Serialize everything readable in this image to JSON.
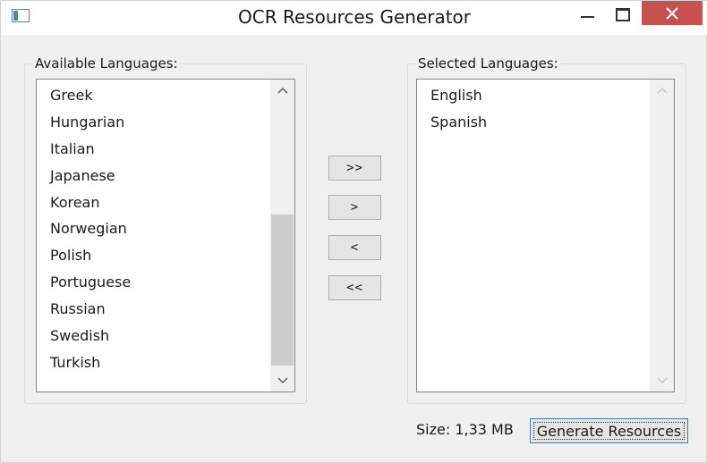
{
  "window": {
    "title": "OCR Resources Generator",
    "icons": {
      "app": "app-window-icon",
      "minimize": "minimize-icon",
      "maximize": "maximize-icon",
      "close": "close-icon"
    },
    "close_color": "#c75050"
  },
  "available": {
    "label": "Available Languages:",
    "items": [
      "Greek",
      "Hungarian",
      "Italian",
      "Japanese",
      "Korean",
      "Norwegian",
      "Polish",
      "Portuguese",
      "Russian",
      "Swedish",
      "Turkish"
    ],
    "scroll_position": 1.0
  },
  "selected": {
    "label": "Selected Languages:",
    "items": [
      "English",
      "Spanish"
    ]
  },
  "buttons": {
    "add_all": ">>",
    "add": ">",
    "remove": "<",
    "remove_all": "<<"
  },
  "footer": {
    "size_text": "Size: 1,33 MB",
    "generate_label": "Generate Resources"
  }
}
